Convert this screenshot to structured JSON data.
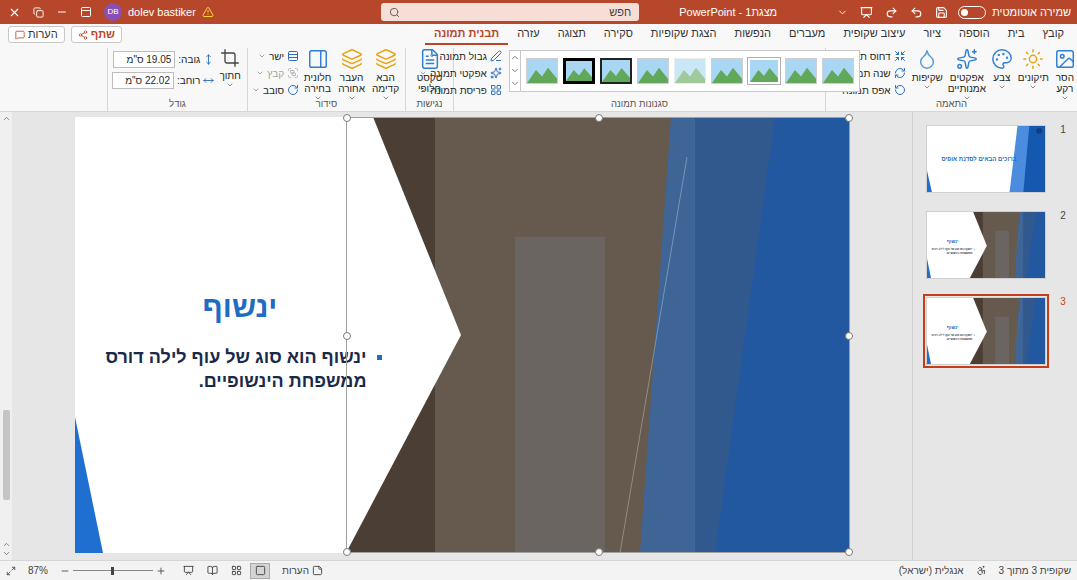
{
  "title_bar": {
    "autosave_label": "שמירה אוטומטית",
    "autosave_on": false,
    "title": "מצגת1 - PowerPoint",
    "search_placeholder": "חפש",
    "user_name": "dolev bastiker",
    "user_initials": "DB"
  },
  "ribbon_tabs": [
    {
      "label": "קובץ",
      "selected": false
    },
    {
      "label": "בית",
      "selected": false
    },
    {
      "label": "הוספה",
      "selected": false
    },
    {
      "label": "ציור",
      "selected": false
    },
    {
      "label": "עיצוב שקופית",
      "selected": false
    },
    {
      "label": "מעברים",
      "selected": false
    },
    {
      "label": "הנפשות",
      "selected": false
    },
    {
      "label": "הצגת שקופיות",
      "selected": false
    },
    {
      "label": "סקירה",
      "selected": false
    },
    {
      "label": "תצוגה",
      "selected": false
    },
    {
      "label": "עזרה",
      "selected": false
    },
    {
      "label": "תבנית תמונה",
      "selected": true
    }
  ],
  "ribbon_buttons": {
    "share": "שתף",
    "comments": "הערות"
  },
  "groups": {
    "adjust": {
      "label": "התאמה",
      "large": [
        "הסר רקע",
        "תיקונים",
        "צבע",
        "אפקטים אמנותיים",
        "שקיפות"
      ],
      "small": [
        "דחוס תמונות",
        "שנה תמונה",
        "אפס תמונה"
      ]
    },
    "picture_styles": {
      "label": "סגנונות תמונה",
      "styles": [
        {
          "kind": "plain",
          "selected": false
        },
        {
          "kind": "plain",
          "selected": false
        },
        {
          "kind": "border",
          "selected": false
        },
        {
          "kind": "plain",
          "selected": false
        },
        {
          "kind": "soft",
          "selected": false
        },
        {
          "kind": "plain",
          "selected": false
        },
        {
          "kind": "black-frame",
          "selected": false
        },
        {
          "kind": "black-thick",
          "selected": false
        },
        {
          "kind": "plain",
          "selected": false
        }
      ],
      "small": [
        "גבול תמונה",
        "אפקטי תמונה",
        "פריסת תמונה"
      ]
    },
    "accessibility": {
      "label": "נגישות",
      "button": "טקסט חלופי"
    },
    "arrange": {
      "label": "סידור",
      "large": [
        "הבא קדימה",
        "העבר אחורה",
        "חלונית בחירה"
      ],
      "small": [
        {
          "label": "ישר",
          "disabled": false
        },
        {
          "label": "קבץ",
          "disabled": true
        },
        {
          "label": "סובב",
          "disabled": false
        }
      ]
    },
    "size": {
      "label": "גודל",
      "crop": "חתוך",
      "fields": [
        {
          "label": "גובה:",
          "value": "19.05 ס\"מ"
        },
        {
          "label": "רוחב:",
          "value": "22.02 ס\"מ"
        }
      ]
    }
  },
  "thumbnails": [
    {
      "number": "1",
      "selected": false,
      "kind": "title",
      "title": "ברוכים הבאים לסדנת אופיס",
      "body": ""
    },
    {
      "number": "2",
      "selected": false,
      "kind": "content",
      "title": "ינשוף",
      "body": "ינשוף הוא סוג של עוף לילה דורס ממשפחת הינשופיים."
    },
    {
      "number": "3",
      "selected": true,
      "kind": "content",
      "title": "ינשוף",
      "body": "ינשוף הוא סוג של עוף לילה דורס ממשפחת הינשופיים."
    }
  ],
  "slide": {
    "title": "ינשוף",
    "bullets": [
      "ינשוף הוא סוג של עוף לילה דורס ממשפחת הינשופיים."
    ],
    "image_selected": true
  },
  "status_bar": {
    "slide_info": "שקופית 3 מתוך 3",
    "language": "אנגלית (ישראל)",
    "notes": "הערות",
    "zoom": "87%",
    "zoom_level": 0.47,
    "views": [
      {
        "kind": "normal",
        "selected": true
      },
      {
        "kind": "sorter",
        "selected": false
      },
      {
        "kind": "reading",
        "selected": false
      },
      {
        "kind": "slideshow",
        "selected": false
      }
    ]
  }
}
